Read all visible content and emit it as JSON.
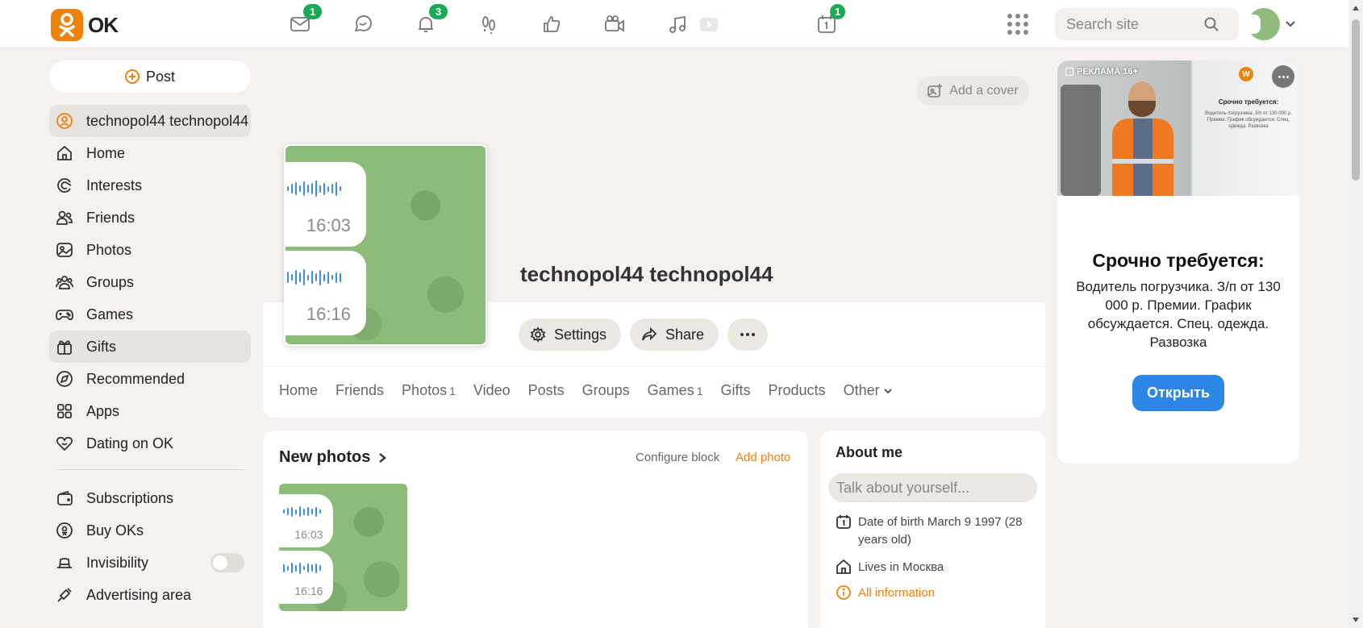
{
  "header": {
    "logo_text": "OK",
    "search_placeholder": "Search site",
    "badges": {
      "messages": "1",
      "notifications": "3",
      "events": "1"
    }
  },
  "sidebar": {
    "post_label": "Post",
    "items": [
      {
        "label": "technopol44 technopol44",
        "icon": "profile-icon"
      },
      {
        "label": "Home",
        "icon": "home-icon"
      },
      {
        "label": "Interests",
        "icon": "interests-icon"
      },
      {
        "label": "Friends",
        "icon": "friends-icon"
      },
      {
        "label": "Photos",
        "icon": "photos-icon"
      },
      {
        "label": "Groups",
        "icon": "groups-icon"
      },
      {
        "label": "Games",
        "icon": "games-icon"
      },
      {
        "label": "Gifts",
        "icon": "gift-icon"
      },
      {
        "label": "Recommended",
        "icon": "compass-icon"
      },
      {
        "label": "Apps",
        "icon": "apps-icon"
      },
      {
        "label": "Dating on OK",
        "icon": "heart-icon"
      }
    ],
    "extra_items": [
      {
        "label": "Subscriptions",
        "icon": "wallet-icon"
      },
      {
        "label": "Buy OKs",
        "icon": "coin-icon"
      },
      {
        "label": "Invisibility",
        "icon": "hat-icon",
        "toggle_on": false
      },
      {
        "label": "Advertising area",
        "icon": "megaphone-icon"
      }
    ]
  },
  "profile": {
    "add_cover_label": "Add a cover",
    "name": "technopol44 technopol44",
    "settings_label": "Settings",
    "share_label": "Share",
    "avatar_times": [
      "16:03",
      "16:16"
    ],
    "tabs": [
      {
        "label": "Home",
        "count": ""
      },
      {
        "label": "Friends",
        "count": ""
      },
      {
        "label": "Photos",
        "count": "1"
      },
      {
        "label": "Video",
        "count": ""
      },
      {
        "label": "Posts",
        "count": ""
      },
      {
        "label": "Groups",
        "count": ""
      },
      {
        "label": "Games",
        "count": "1"
      },
      {
        "label": "Gifts",
        "count": ""
      },
      {
        "label": "Products",
        "count": ""
      },
      {
        "label": "Other",
        "count": ""
      }
    ]
  },
  "new_photos": {
    "title": "New photos",
    "configure_label": "Configure block",
    "add_photo_label": "Add photo",
    "photo_times": [
      "16:03",
      "16:16"
    ]
  },
  "about": {
    "title": "About me",
    "input_placeholder": "Talk about yourself...",
    "birth": "Date of birth March 9 1997 (28 years old)",
    "lives": "Lives in Москва",
    "all_info": "All information"
  },
  "ad": {
    "tag": "РЕКЛАМА  16+",
    "logo_letter": "W",
    "mini_title": "Срочно требуется:",
    "mini_text": "Водитель погрузчика. З/п от 130 000 р. Премии. График обсуждается. Спец. одежда. Развозка",
    "title": "Срочно требуется:",
    "text": "Водитель погрузчика. З/п от 130 000 р. Премии. График обсуждается. Спец. одежда. Развозка",
    "button_label": "Открыть"
  },
  "colors": {
    "accent": "#ee8208",
    "badge": "#1aaa55",
    "ad_button": "#2b86e8"
  }
}
